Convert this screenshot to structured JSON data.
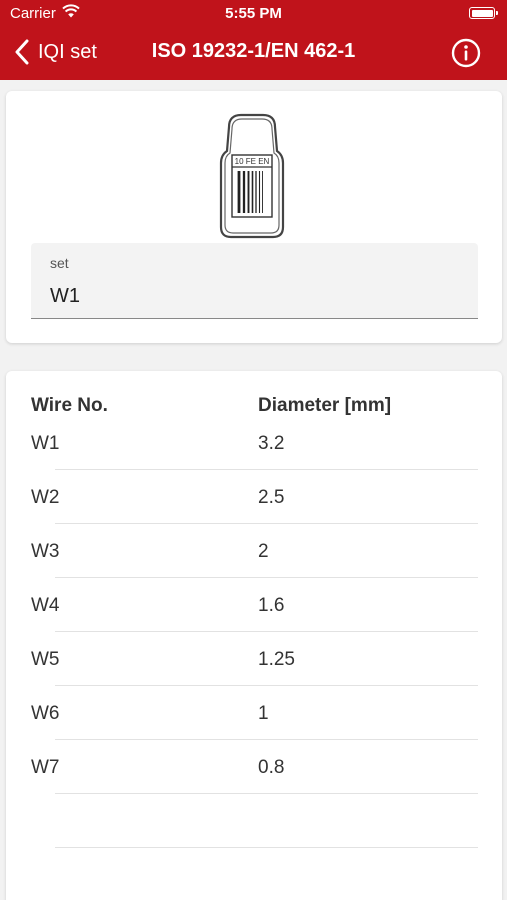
{
  "status_bar": {
    "carrier": "Carrier",
    "time": "5:55 PM"
  },
  "nav": {
    "back_label": "IQI set",
    "title": "ISO 19232-1/EN 462-1",
    "accent_color": "#c0131b"
  },
  "iqi_image": {
    "label": "10 FE EN"
  },
  "set_field": {
    "label": "set",
    "value": "W1"
  },
  "table": {
    "headers": [
      "Wire No.",
      "Diameter [mm]"
    ],
    "rows": [
      [
        "W1",
        "3.2"
      ],
      [
        "W2",
        "2.5"
      ],
      [
        "W3",
        "2"
      ],
      [
        "W4",
        "1.6"
      ],
      [
        "W5",
        "1.25"
      ],
      [
        "W6",
        "1"
      ],
      [
        "W7",
        "0.8"
      ],
      [
        "",
        ""
      ]
    ]
  }
}
